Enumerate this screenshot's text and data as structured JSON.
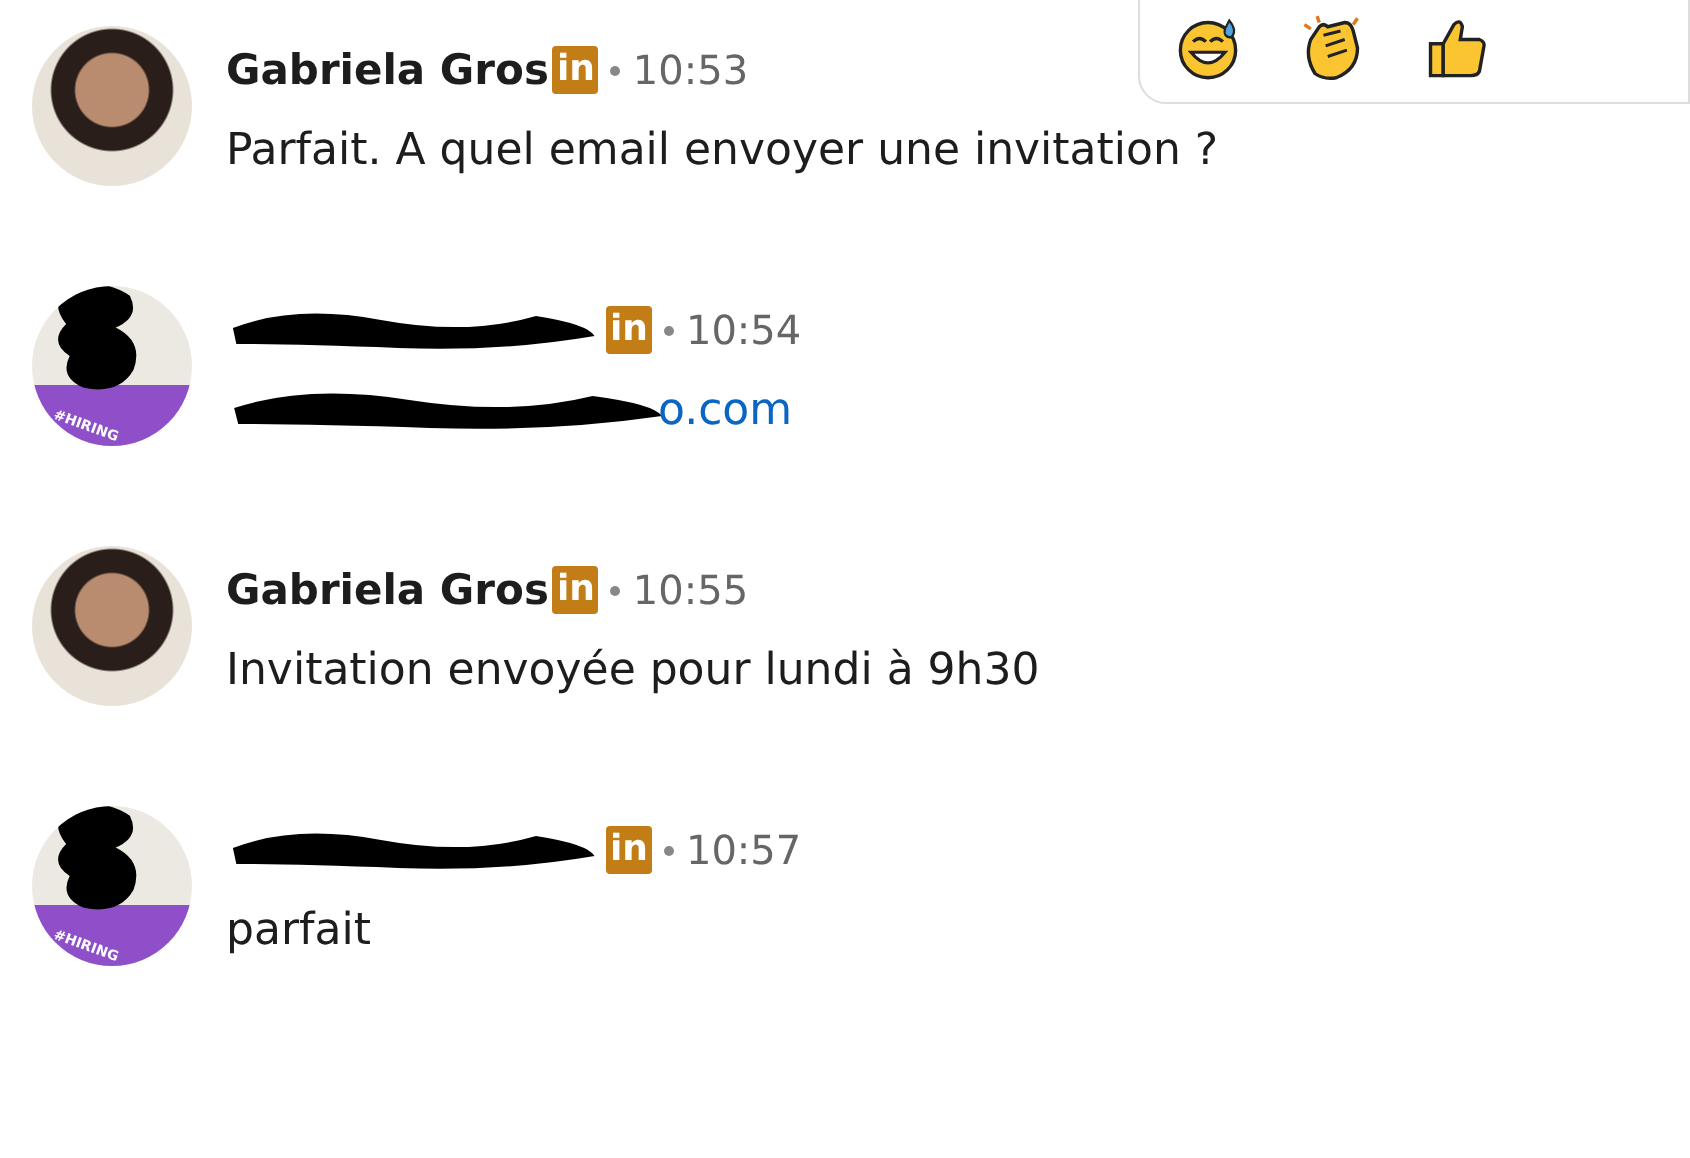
{
  "reaction_bar": {
    "reactions": [
      {
        "kind": "sweat-smile"
      },
      {
        "kind": "clap"
      },
      {
        "kind": "thumbs-up"
      }
    ]
  },
  "messages": [
    {
      "avatar": {
        "kind": "photo"
      },
      "author": "Gabriela Gros",
      "author_redacted": false,
      "badge": "in",
      "time": "10:53",
      "body": {
        "kind": "text",
        "text": "Parfait. A quel email envoyer une invitation ?",
        "redacted": false
      }
    },
    {
      "avatar": {
        "kind": "hiring",
        "frame_label": "#HIRING"
      },
      "author_redacted": true,
      "badge": "in",
      "time": "10:54",
      "body": {
        "kind": "link",
        "text": "o.com",
        "redacted": true
      }
    },
    {
      "avatar": {
        "kind": "photo"
      },
      "author": "Gabriela Gros",
      "author_redacted": false,
      "badge": "in",
      "time": "10:55",
      "body": {
        "kind": "text",
        "text": "Invitation envoyée pour lundi à 9h30",
        "redacted": false
      }
    },
    {
      "avatar": {
        "kind": "hiring",
        "frame_label": "#HIRING"
      },
      "author_redacted": true,
      "badge": "in",
      "time": "10:57",
      "body": {
        "kind": "text",
        "text": "parfait",
        "redacted": false
      }
    }
  ]
}
